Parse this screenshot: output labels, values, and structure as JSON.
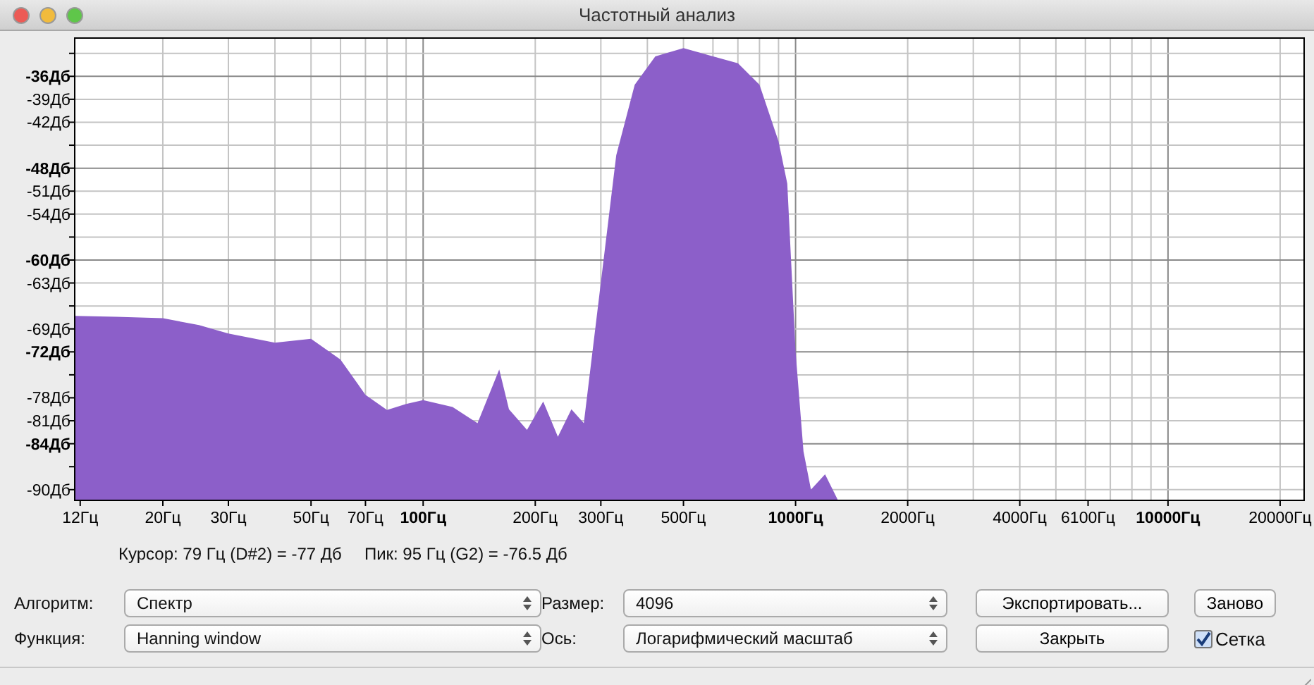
{
  "window": {
    "title": "Частотный анализ"
  },
  "spectrum": {
    "y_axis_labels": [
      {
        "text": "-36Дб",
        "major": true
      },
      {
        "text": "-39Дб",
        "major": false
      },
      {
        "text": "-42Дб",
        "major": false
      },
      {
        "text": "-48Дб",
        "major": true
      },
      {
        "text": "-51Дб",
        "major": false
      },
      {
        "text": "-54Дб",
        "major": false
      },
      {
        "text": "-60Дб",
        "major": true
      },
      {
        "text": "-63Дб",
        "major": false
      },
      {
        "text": "-69Дб",
        "major": false
      },
      {
        "text": "-72Дб",
        "major": true
      },
      {
        "text": "-78Дб",
        "major": false
      },
      {
        "text": "-81Дб",
        "major": false
      },
      {
        "text": "-84Дб",
        "major": true
      },
      {
        "text": "-90Дб",
        "major": false
      }
    ],
    "x_axis_labels": [
      {
        "text": "12Гц",
        "major": false
      },
      {
        "text": "20Гц",
        "major": false
      },
      {
        "text": "30Гц",
        "major": false
      },
      {
        "text": "50Гц",
        "major": false
      },
      {
        "text": "70Гц",
        "major": false
      },
      {
        "text": "100Гц",
        "major": true
      },
      {
        "text": "200Гц",
        "major": false
      },
      {
        "text": "300Гц",
        "major": false
      },
      {
        "text": "500Гц",
        "major": false
      },
      {
        "text": "1000Гц",
        "major": true
      },
      {
        "text": "2000Гц",
        "major": false
      },
      {
        "text": "4000Гц",
        "major": false
      },
      {
        "text": "6100Гц",
        "major": false
      },
      {
        "text": "10000Гц",
        "major": true
      },
      {
        "text": "20000Гц",
        "major": false
      }
    ]
  },
  "cursor_readout": "Курсор: 79 Гц (D#2) = -77 Дб",
  "peak_readout": "Пик: 95 Гц (G2) = -76.5 Дб",
  "controls": {
    "algorithm": {
      "label": "Алгоритм:",
      "value": "Спектр"
    },
    "size": {
      "label": "Размер:",
      "value": "4096"
    },
    "function": {
      "label": "Функция:",
      "value": "Hanning window"
    },
    "axis": {
      "label": "Ось:",
      "value": "Логарифмический масштаб"
    }
  },
  "buttons": [
    {
      "label": "Экспортировать..."
    },
    {
      "label": "Заново"
    },
    {
      "label": "Закрыть"
    }
  ],
  "grid_checkbox": {
    "label": "Сетка",
    "checked": true
  }
}
